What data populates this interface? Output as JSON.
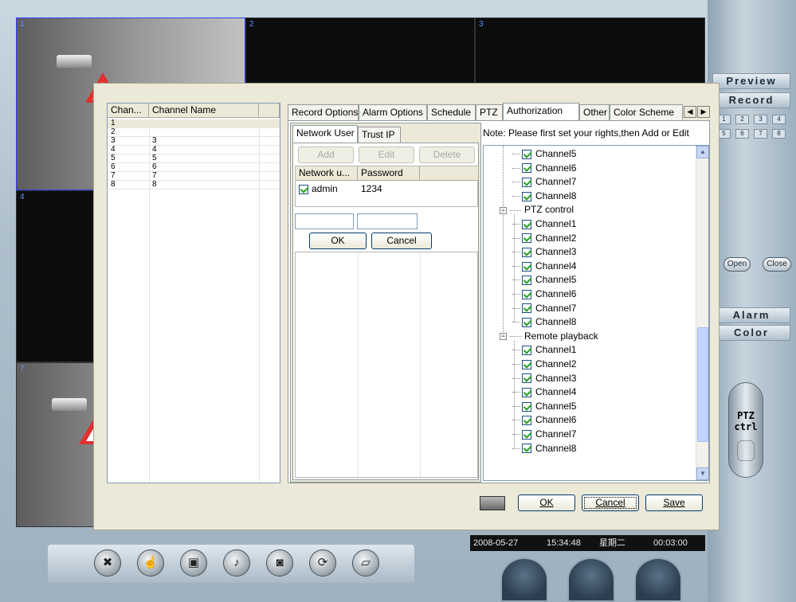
{
  "video_grid": {
    "cells": [
      "1",
      "2",
      "3",
      "4",
      "",
      "",
      "7"
    ]
  },
  "right_panel": {
    "preview": "Preview",
    "record": "Record",
    "channel_numbers": [
      "1",
      "2",
      "3",
      "4",
      "5",
      "6",
      "7",
      "8"
    ],
    "open": "Open",
    "close": "Close",
    "alarm": "Alarm",
    "color": "Color",
    "ptz_top": "PTZ",
    "ptz_bottom": "ctrl"
  },
  "status_bar": {
    "date": "2008-05-27",
    "time": "15:34:48",
    "weekday": "星期二",
    "duration": "00:03:00"
  },
  "dialog": {
    "channel_list": {
      "col_num": "Chan...",
      "col_name": "Channel Name",
      "rows": [
        {
          "num": "1",
          "name": ""
        },
        {
          "num": "2",
          "name": ""
        },
        {
          "num": "3",
          "name": "3"
        },
        {
          "num": "4",
          "name": "4"
        },
        {
          "num": "5",
          "name": "5"
        },
        {
          "num": "6",
          "name": "6"
        },
        {
          "num": "7",
          "name": "7"
        },
        {
          "num": "8",
          "name": "8"
        }
      ]
    },
    "tabs": [
      "Record Options",
      "Alarm Options",
      "Schedule",
      "PTZ",
      "Authorization",
      "Other",
      "Color Scheme"
    ],
    "subtabs": [
      "Network User",
      "Trust IP"
    ],
    "buttons": {
      "add": "Add",
      "edit": "Edit",
      "delete": "Delete",
      "ok": "OK",
      "cancel": "Cancel"
    },
    "note": "Note: Please first set your rights,then Add or Edit",
    "users_table": {
      "col_user": "Network u...",
      "col_pass": "Password",
      "rows": [
        {
          "user": "admin",
          "password": "1234",
          "checked": true
        }
      ]
    },
    "tree": {
      "top_channels": [
        "Channel5",
        "Channel6",
        "Channel7",
        "Channel8"
      ],
      "ptz_label": "PTZ control",
      "ptz_channels": [
        "Channel1",
        "Channel2",
        "Channel3",
        "Channel4",
        "Channel5",
        "Channel6",
        "Channel7",
        "Channel8"
      ],
      "playback_label": "Remote playback",
      "playback_channels": [
        "Channel1",
        "Channel2",
        "Channel3",
        "Channel4",
        "Channel5",
        "Channel6",
        "Channel7",
        "Channel8"
      ]
    },
    "footer": {
      "ok": "OK",
      "cancel": "Cancel",
      "save": "Save"
    }
  }
}
